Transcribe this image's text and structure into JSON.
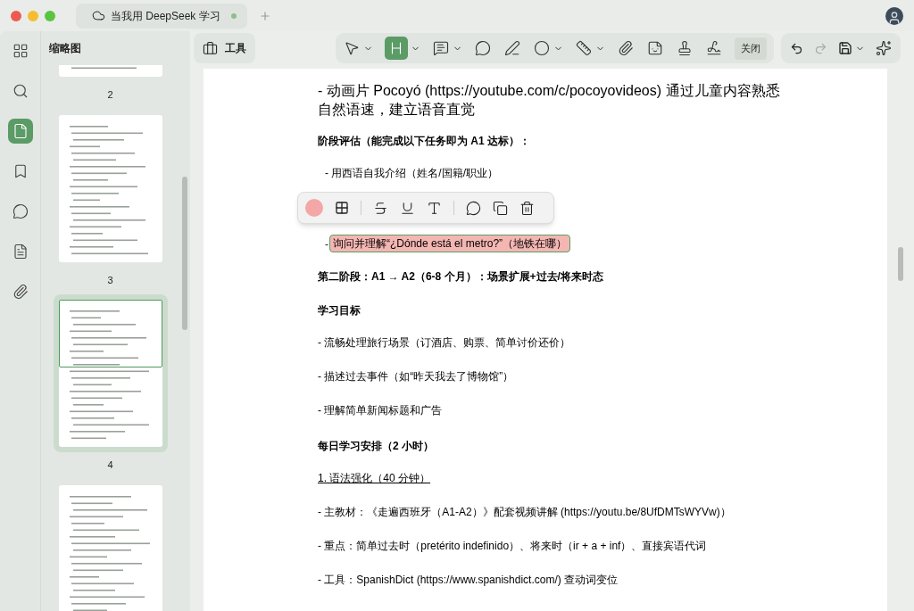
{
  "window": {
    "tab_title": "当我用 DeepSeek 学习",
    "tab_modified": true
  },
  "rail": [
    {
      "kind": "grid",
      "selected": false
    },
    {
      "kind": "search",
      "selected": false
    },
    {
      "kind": "page",
      "selected": true
    },
    {
      "kind": "bookmark",
      "selected": false
    },
    {
      "kind": "comment",
      "selected": false
    },
    {
      "kind": "document",
      "selected": false
    },
    {
      "kind": "attachment",
      "selected": false
    }
  ],
  "thumbnails_panel": {
    "title": "缩略图",
    "pages": [
      {
        "label": "2",
        "selected": false
      },
      {
        "label": "3",
        "selected": false
      },
      {
        "label": "4",
        "selected": true
      },
      {
        "selected": false
      }
    ]
  },
  "toolbar": {
    "tools_button": "工具",
    "tools": [
      {
        "kind": "select",
        "selected": false,
        "dropdown": true
      },
      {
        "kind": "highlight",
        "selected": true,
        "dropdown": true
      },
      {
        "kind": "note",
        "selected": false,
        "dropdown": true
      },
      {
        "kind": "comment",
        "selected": false,
        "dropdown": false
      },
      {
        "kind": "pen",
        "selected": false,
        "dropdown": false
      },
      {
        "kind": "shape",
        "selected": false,
        "dropdown": true
      },
      {
        "kind": "measure",
        "selected": false,
        "dropdown": true
      },
      {
        "kind": "attach",
        "selected": false,
        "dropdown": false
      },
      {
        "kind": "sticker",
        "selected": false,
        "dropdown": false
      },
      {
        "kind": "stamp",
        "selected": false,
        "dropdown": false
      },
      {
        "kind": "signature",
        "selected": false,
        "dropdown": false
      }
    ],
    "close_button": "关闭"
  },
  "document": [
    {
      "kind": "large",
      "text": "- 动画片 Pocoyó (https://youtube.com/c/pocoyovideos)  通过儿童内容熟悉自然语速，建立语音直觉"
    },
    {
      "kind": "heading",
      "text": "阶段评估（能完成以下任务即为 A1 达标）："
    },
    {
      "kind": "subitem",
      "text": "- 用西语自我介绍（姓名/国籍/职业）"
    },
    {
      "kind": "annotation_popup",
      "color": "#f4a7a7"
    },
    {
      "kind": "highlight",
      "bullet": "-",
      "text": "询问并理解“¿Dónde está el metro?”（地铁在哪）"
    },
    {
      "kind": "heading",
      "text": "第二阶段：A1 → A2（6-8 个月）：场景扩展+过去/将来时态"
    },
    {
      "kind": "heading",
      "text": "学习目标"
    },
    {
      "kind": "item",
      "text": "- 流畅处理旅行场景（订酒店、购票、简单讨价还价）"
    },
    {
      "kind": "item",
      "text": "- 描述过去事件（如“昨天我去了博物馆”）"
    },
    {
      "kind": "item",
      "text": "- 理解简单新闻标题和广告"
    },
    {
      "kind": "heading",
      "text": "每日学习安排（2 小时）"
    },
    {
      "kind": "underline",
      "text": "1. 语法强化（40 分钟）"
    },
    {
      "kind": "item",
      "text": "- 主教材：《走遍西班牙（A1-A2）》配套视频讲解 (https://youtu.be/8UfDMTsWYVw)）"
    },
    {
      "kind": "item",
      "text": "- 重点：简单过去时（pretérito indefinido）、将来时（ir + a + inf）、直接宾语代词"
    },
    {
      "kind": "item",
      "text": "- 工具：SpanishDict (https://www.spanishdict.com/)  查动词变位"
    }
  ]
}
